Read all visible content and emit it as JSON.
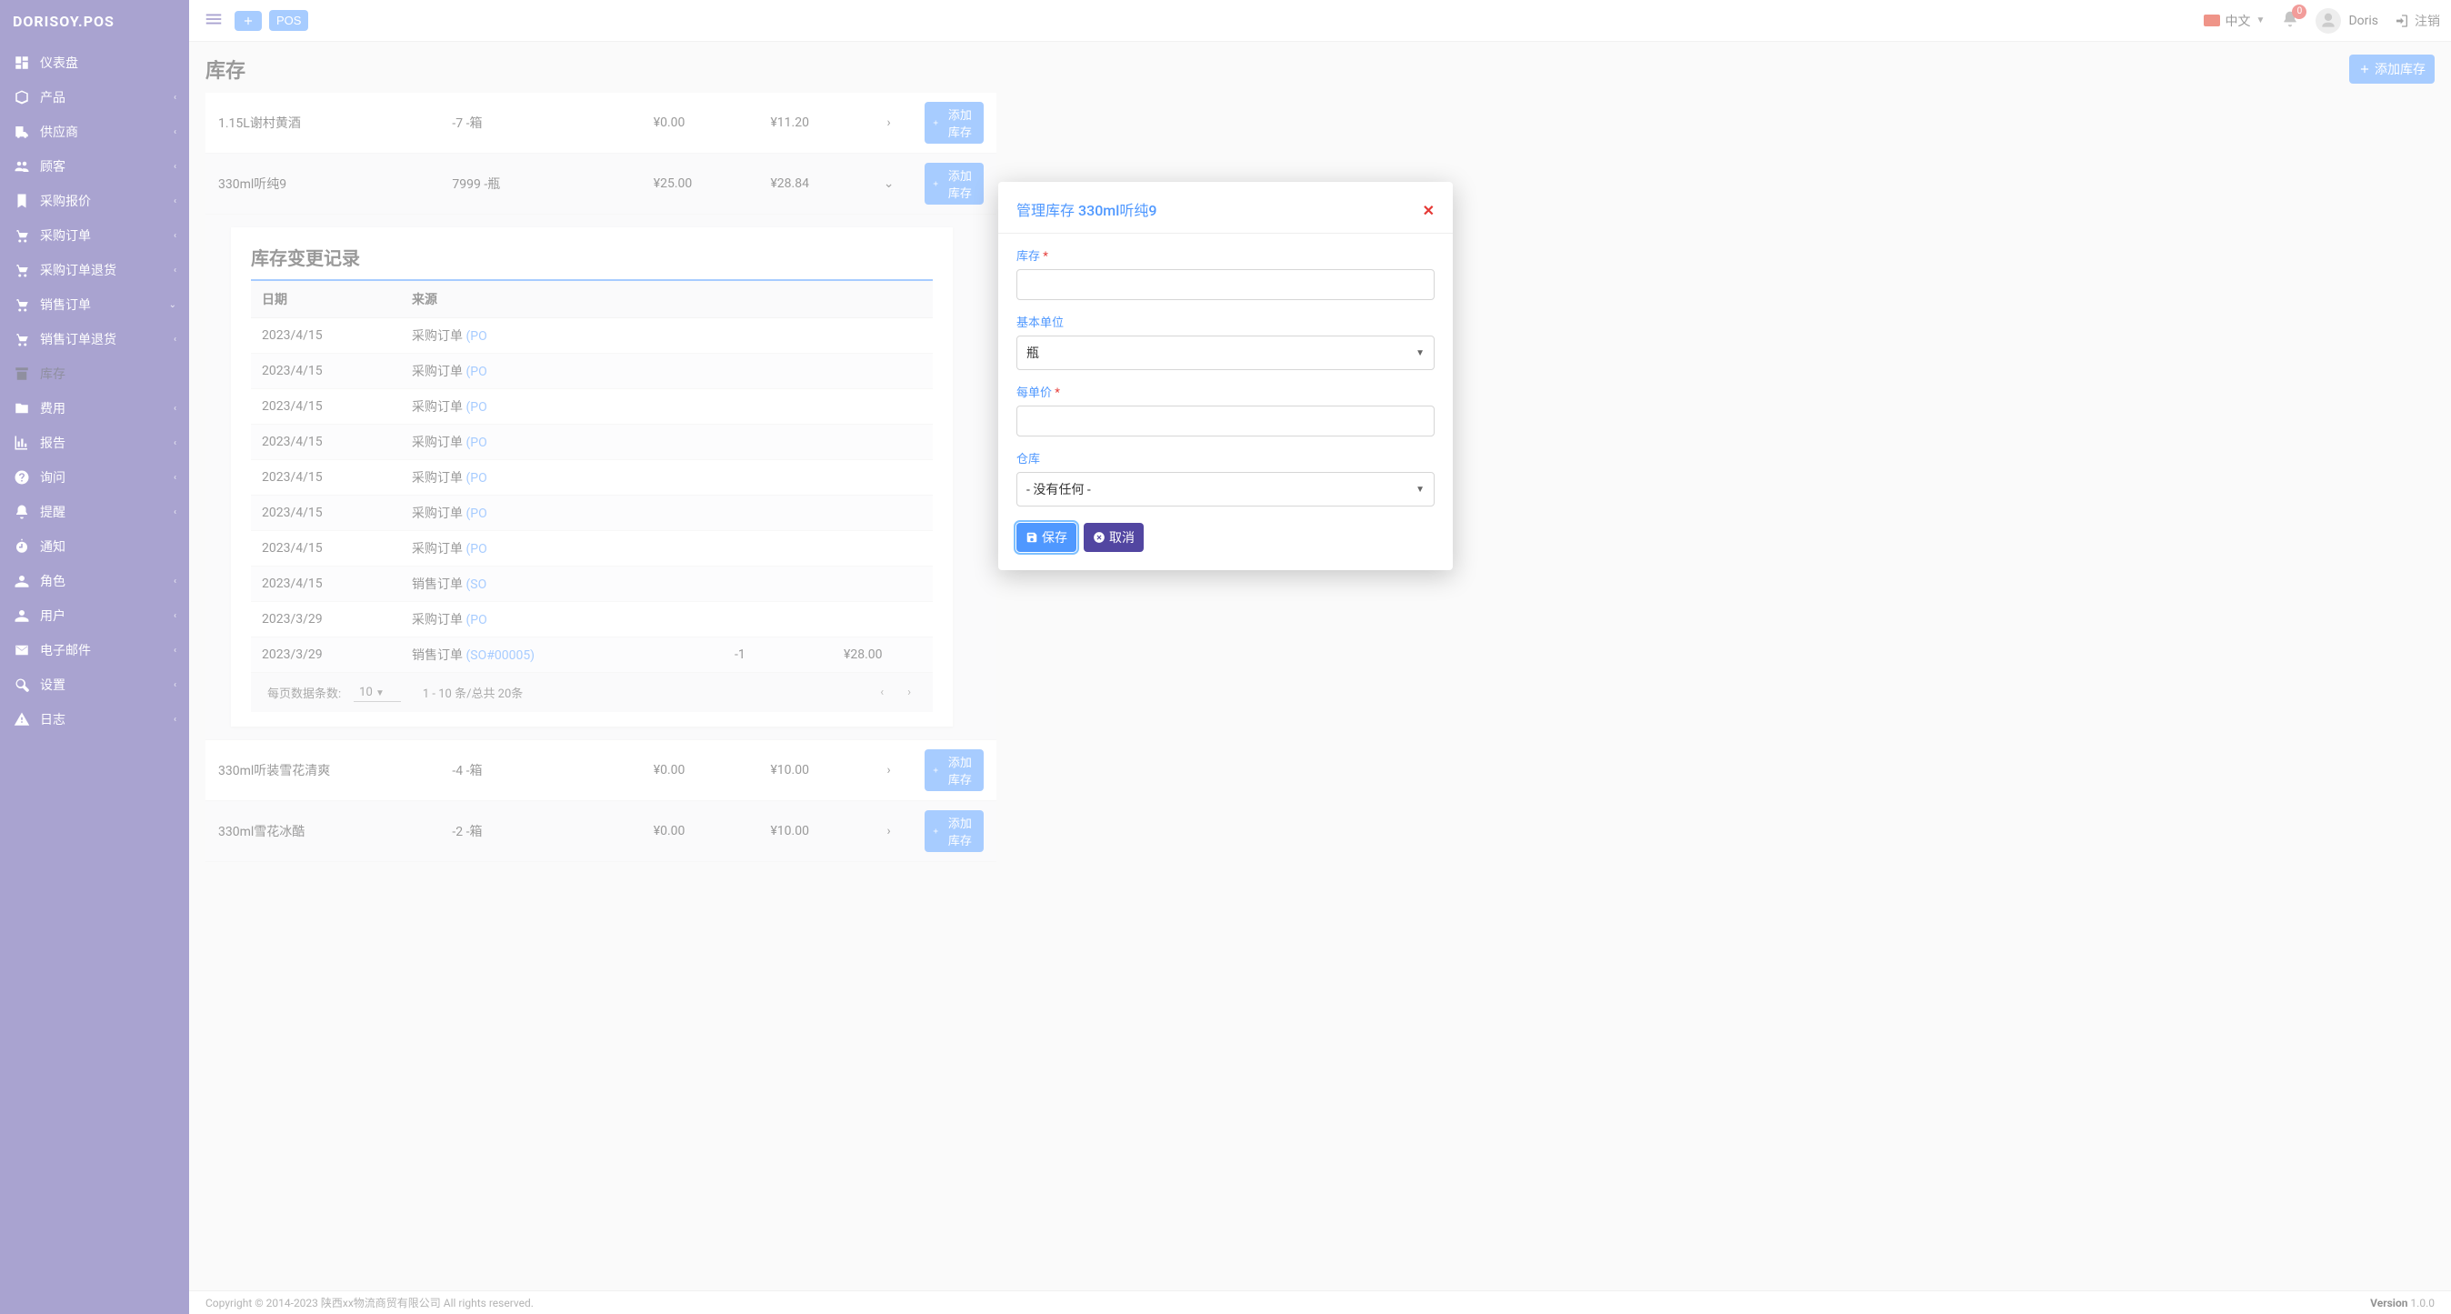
{
  "brand": "DORISOY.POS",
  "topbar": {
    "pos_label": "POS",
    "lang": "中文",
    "notif_count": "0",
    "username": "Doris",
    "logout": "注销"
  },
  "sidebar": {
    "items": [
      {
        "label": "仪表盘",
        "icon": "dashboard",
        "expandable": false
      },
      {
        "label": "产品",
        "icon": "product",
        "expandable": true
      },
      {
        "label": "供应商",
        "icon": "truck",
        "expandable": true
      },
      {
        "label": "顾客",
        "icon": "users",
        "expandable": true
      },
      {
        "label": "采购报价",
        "icon": "bookmark",
        "expandable": true
      },
      {
        "label": "采购订单",
        "icon": "cart",
        "expandable": true
      },
      {
        "label": "采购订单退货",
        "icon": "cart",
        "expandable": true
      },
      {
        "label": "销售订单",
        "icon": "cart",
        "expandable": true,
        "open": true
      },
      {
        "label": "销售订单退货",
        "icon": "cart",
        "expandable": true
      },
      {
        "label": "库存",
        "icon": "archive",
        "expandable": false,
        "active": true
      },
      {
        "label": "费用",
        "icon": "folder",
        "expandable": true
      },
      {
        "label": "报告",
        "icon": "chart",
        "expandable": true
      },
      {
        "label": "询问",
        "icon": "question",
        "expandable": true
      },
      {
        "label": "提醒",
        "icon": "bell",
        "expandable": true
      },
      {
        "label": "通知",
        "icon": "stopwatch",
        "expandable": false
      },
      {
        "label": "角色",
        "icon": "users2",
        "expandable": true
      },
      {
        "label": "用户",
        "icon": "users2",
        "expandable": true
      },
      {
        "label": "电子邮件",
        "icon": "mail",
        "expandable": true
      },
      {
        "label": "设置",
        "icon": "tools",
        "expandable": true
      },
      {
        "label": "日志",
        "icon": "warn",
        "expandable": true
      }
    ]
  },
  "page": {
    "title": "库存",
    "add_button": "添加库存"
  },
  "inventory_rows": [
    {
      "name": "1.15L谢村黄酒",
      "qty": "-7 -箱",
      "price1": "¥0.00",
      "price2": "¥11.20",
      "expanded": false
    },
    {
      "name": "330ml听纯9",
      "qty": "7999 -瓶",
      "price1": "¥25.00",
      "price2": "¥28.84",
      "expanded": true,
      "alt": true
    },
    {
      "name": "330ml听装雪花清爽",
      "qty": "-4 -箱",
      "price1": "¥0.00",
      "price2": "¥10.00",
      "expanded": false
    },
    {
      "name": "330ml雪花冰酷",
      "qty": "-2 -箱",
      "price1": "¥0.00",
      "price2": "¥10.00",
      "expanded": false,
      "alt": true
    }
  ],
  "row_action": "添加库存",
  "detail": {
    "title": "库存变更记录",
    "headers": {
      "date": "日期",
      "source": "来源"
    },
    "rows": [
      {
        "date": "2023/4/15",
        "source_a": "采购订单 ",
        "source_b": "(PO",
        "qty": "",
        "price": ""
      },
      {
        "date": "2023/4/15",
        "source_a": "采购订单 ",
        "source_b": "(PO",
        "qty": "",
        "price": ""
      },
      {
        "date": "2023/4/15",
        "source_a": "采购订单 ",
        "source_b": "(PO",
        "qty": "",
        "price": ""
      },
      {
        "date": "2023/4/15",
        "source_a": "采购订单 ",
        "source_b": "(PO",
        "qty": "",
        "price": ""
      },
      {
        "date": "2023/4/15",
        "source_a": "采购订单 ",
        "source_b": "(PO",
        "qty": "",
        "price": ""
      },
      {
        "date": "2023/4/15",
        "source_a": "采购订单 ",
        "source_b": "(PO",
        "qty": "",
        "price": ""
      },
      {
        "date": "2023/4/15",
        "source_a": "采购订单 ",
        "source_b": "(PO",
        "qty": "",
        "price": ""
      },
      {
        "date": "2023/4/15",
        "source_a": "销售订单 ",
        "source_b": "(SO",
        "qty": "",
        "price": ""
      },
      {
        "date": "2023/3/29",
        "source_a": "采购订单 ",
        "source_b": "(PO",
        "qty": "",
        "price": ""
      },
      {
        "date": "2023/3/29",
        "source_a": "销售订单 ",
        "source_b": "(SO#00005)",
        "qty": "-1",
        "price": "¥28.00"
      }
    ],
    "paginator": {
      "per_page_label": "每页数据条数:",
      "per_page_value": "10",
      "range": "1 - 10 条/总共 20条"
    }
  },
  "modal": {
    "title_a": "管理库存",
    "title_b": "330ml听纯9",
    "stock_label": "库存",
    "unit_label": "基本单位",
    "unit_value": "瓶",
    "price_label": "每单价",
    "warehouse_label": "仓库",
    "warehouse_value": "- 没有任何 -",
    "save": "保存",
    "cancel": "取消"
  },
  "footer": {
    "left": "Copyright © 2014-2023 陕西xx物流商贸有限公司 All rights reserved.",
    "right_a": "Version",
    "right_b": " 1.0.0"
  }
}
